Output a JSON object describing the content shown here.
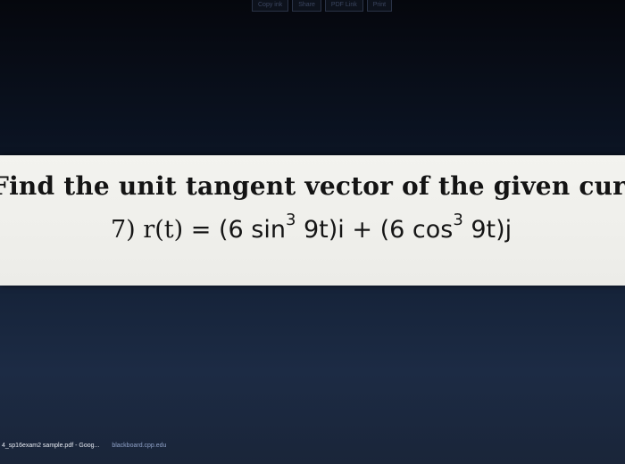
{
  "toolbar": {
    "buttons": [
      "Copy ink",
      "Share",
      "PDF Link",
      "Print"
    ]
  },
  "problem": {
    "heading": "Find the unit tangent vector of the given curve.",
    "number": "7)",
    "function": "r(t)",
    "equals": "=",
    "term1_open": "(6 sin",
    "term1_power": "3",
    "term1_close": " 9t)i",
    "plus": "+",
    "term2_open": "(6 cos",
    "term2_power": "3",
    "term2_close": " 9t)j"
  },
  "bottom_bar": {
    "left_tab": "4_sp16exam2 sample.pdf - Goog...",
    "right_tab": "blackboard.cpp.edu"
  },
  "colors": {
    "background": "#0b1322",
    "panel": "#f3f3ef",
    "text": "#141414"
  }
}
